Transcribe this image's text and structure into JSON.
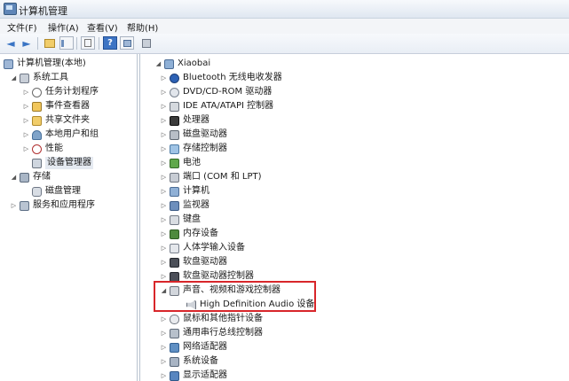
{
  "window": {
    "title": "计算机管理"
  },
  "menu": {
    "file": "文件(F)",
    "action": "操作(A)",
    "view": "查看(V)",
    "help": "帮助(H)"
  },
  "toolbar": {
    "back": "◄",
    "forward": "►",
    "help": "?"
  },
  "left_tree": {
    "root": "计算机管理(本地)",
    "system_tools": "系统工具",
    "task_scheduler": "任务计划程序",
    "event_viewer": "事件查看器",
    "shared_folders": "共享文件夹",
    "local_users": "本地用户和组",
    "performance": "性能",
    "device_manager": "设备管理器",
    "storage": "存储",
    "disk_management": "磁盘管理",
    "services": "服务和应用程序"
  },
  "devices": {
    "host": "Xiaobai",
    "items": [
      "Bluetooth 无线电收发器",
      "DVD/CD-ROM 驱动器",
      "IDE ATA/ATAPI 控制器",
      "处理器",
      "磁盘驱动器",
      "存储控制器",
      "电池",
      "端口 (COM 和 LPT)",
      "计算机",
      "监视器",
      "键盘",
      "内存设备",
      "人体学输入设备",
      "软盘驱动器",
      "软盘驱动器控制器",
      "声音、视频和游戏控制器",
      "High Definition Audio 设备",
      "鼠标和其他指针设备",
      "通用串行总线控制器",
      "网络适配器",
      "系统设备",
      "显示适配器"
    ]
  }
}
